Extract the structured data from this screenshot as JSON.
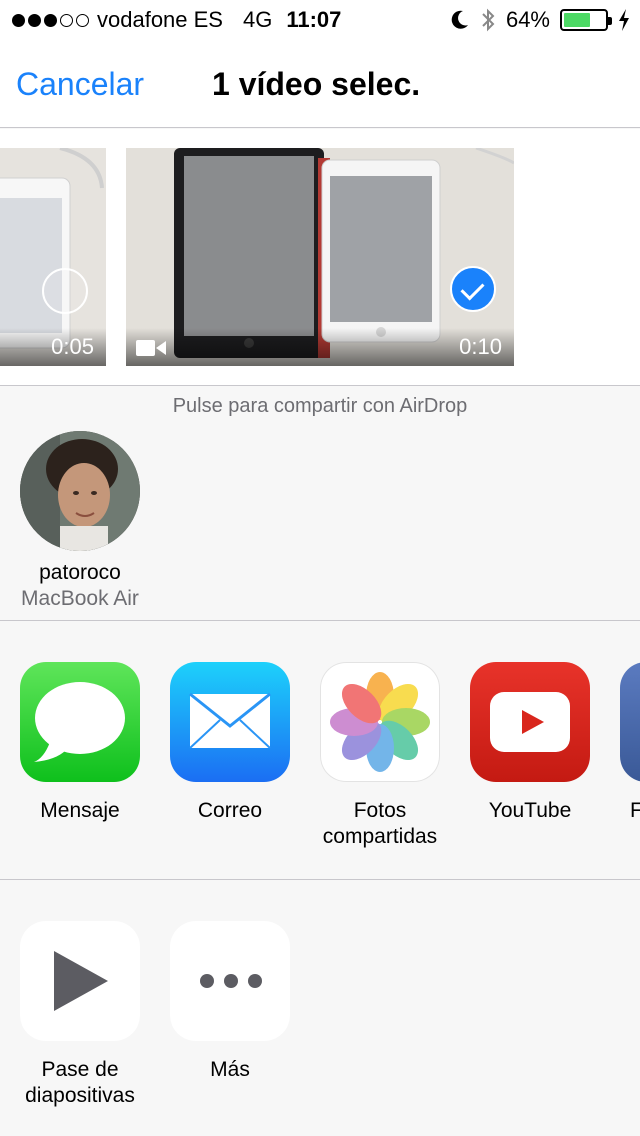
{
  "status_bar": {
    "signal_bars": 3,
    "signal_total": 5,
    "carrier": "vodafone ES",
    "network": "4G",
    "time": "11:07",
    "battery": "64%",
    "battery_level": 0.64
  },
  "nav": {
    "cancel_label": "Cancelar",
    "title": "1 vídeo selec."
  },
  "thumbnails": [
    {
      "duration": "0:05",
      "selected": false
    },
    {
      "duration": "0:10",
      "selected": true
    }
  ],
  "airdrop": {
    "hint": "Pulse para compartir con AirDrop",
    "contacts": [
      {
        "name": "patoroco",
        "device": "MacBook Air"
      }
    ]
  },
  "apps": [
    {
      "label": "Mensaje",
      "icon": "messages-icon"
    },
    {
      "label": "Correo",
      "icon": "mail-icon"
    },
    {
      "label": "Fotos\ncompartidas",
      "icon": "photos-icon"
    },
    {
      "label": "YouTube",
      "icon": "youtube-icon"
    },
    {
      "label": "F",
      "icon": "facebook-icon"
    }
  ],
  "actions": [
    {
      "label": "Pase de\ndiapositivas",
      "icon": "play-icon"
    },
    {
      "label": "Más",
      "icon": "more-icon"
    }
  ],
  "colors": {
    "accent": "#1a82fb",
    "battery_fill": "#4cd964",
    "separator": "#c8c7cc"
  }
}
